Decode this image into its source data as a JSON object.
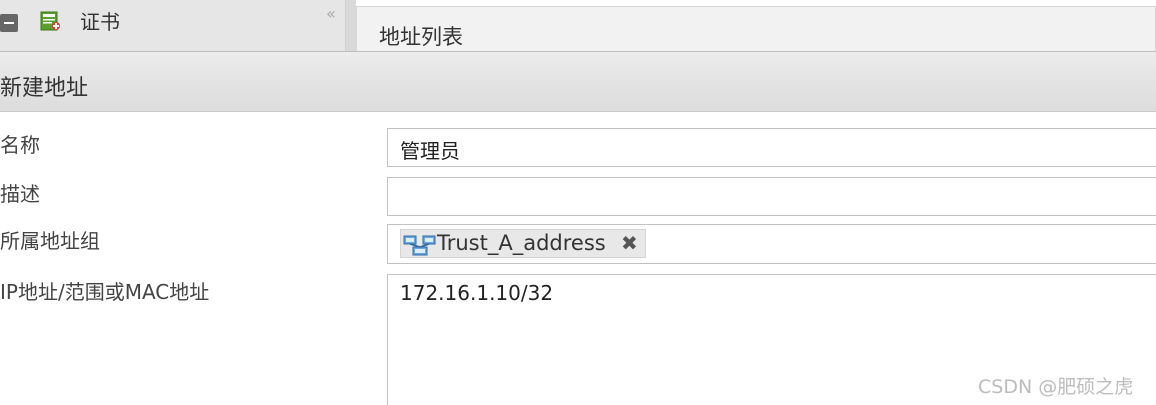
{
  "sidebar": {
    "item_label": "证书",
    "item_icon": "certificate-icon",
    "collapse_icon": "double-chevron-left-icon",
    "collapse_glyph": "«"
  },
  "panel": {
    "title": "地址列表"
  },
  "dialog": {
    "title": "新建地址",
    "fields": {
      "name": {
        "label": "名称",
        "value": "管理员"
      },
      "description": {
        "label": "描述",
        "value": ""
      },
      "group": {
        "label": "所属地址组",
        "tag_label": "Trust_A_address",
        "tag_icon": "network-group-icon",
        "remove_glyph": "✖"
      },
      "ip": {
        "label": "IP地址/范围或MAC地址",
        "value": "172.16.1.10/32"
      }
    }
  },
  "watermark": "CSDN @肥硕之虎",
  "colors": {
    "header_bg": "#dcdcdc",
    "border": "#c2c2c2",
    "tag_bg": "#e8e8e8"
  }
}
